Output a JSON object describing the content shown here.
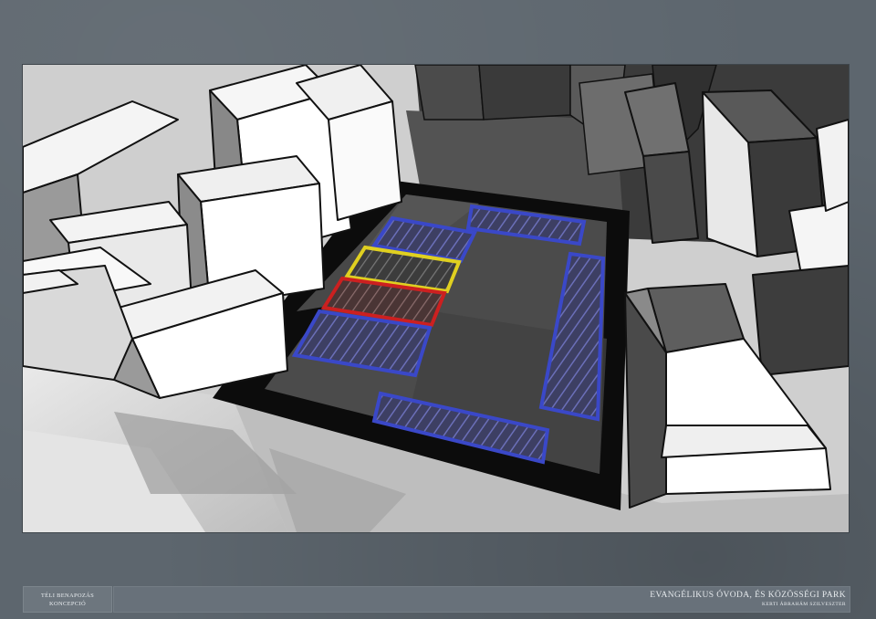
{
  "footer": {
    "left_label_line1": "TÉLI BENAPOZÁS",
    "left_label_line2": "KONCEPCIÓ",
    "project_title": "EVANGÉLIKUS ÓVODA, ÉS KÖZÖSSÉGI PARK",
    "author": "KERTI ÁBRAHÁM SZILVESZTER"
  },
  "zone_colors": {
    "blue": "#3a48c8",
    "yellow": "#e0d020",
    "red": "#cc2020",
    "courtyard": "#4a4a4a",
    "frame_black": "#0c0c0c"
  }
}
